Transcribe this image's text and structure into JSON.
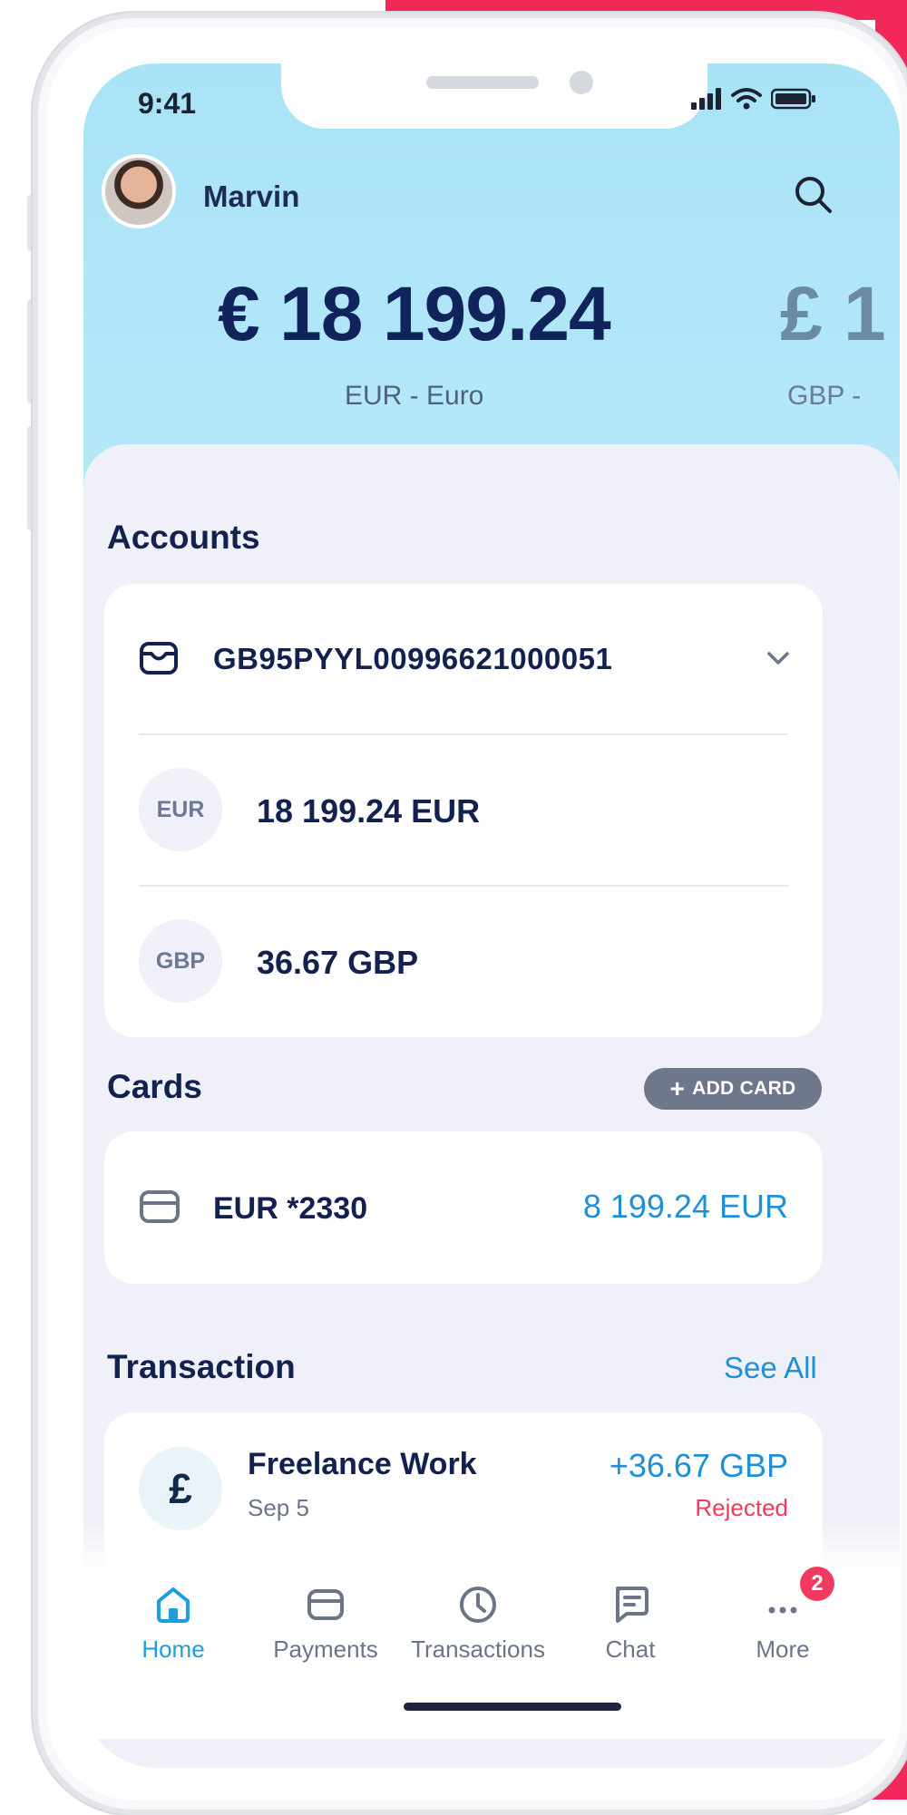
{
  "status_bar": {
    "time": "9:41"
  },
  "header": {
    "user_name": "Marvin",
    "balances": [
      {
        "amount": "€ 18 199.24",
        "currency_label": "EUR - Euro"
      },
      {
        "amount": "£ 1",
        "currency_label": "GBP -"
      }
    ]
  },
  "accounts": {
    "title": "Accounts",
    "iban": "GB95PYYL00996621000051",
    "rows": [
      {
        "badge": "EUR",
        "amount": "18 199.24 EUR"
      },
      {
        "badge": "GBP",
        "amount": "36.67 GBP"
      }
    ]
  },
  "cards": {
    "title": "Cards",
    "add_label": "ADD CARD",
    "items": [
      {
        "name": "EUR *2330",
        "amount": "8 199.24 EUR"
      }
    ]
  },
  "transactions": {
    "title": "Transaction",
    "see_all": "See All",
    "items": [
      {
        "icon_symbol": "£",
        "title": "Freelance Work",
        "date": "Sep 5",
        "amount": "+36.67 GBP",
        "status": "Rejected"
      }
    ]
  },
  "tabbar": {
    "items": [
      {
        "label": "Home",
        "icon": "home-icon"
      },
      {
        "label": "Payments",
        "icon": "card-icon"
      },
      {
        "label": "Transactions",
        "icon": "clock-icon"
      },
      {
        "label": "Chat",
        "icon": "chat-icon"
      },
      {
        "label": "More",
        "icon": "more-icon"
      }
    ],
    "more_badge": "2"
  },
  "colors": {
    "accent": "#1b9fdc",
    "brand_pink": "#f2285a",
    "negative": "#f03a5f",
    "hero_bg": "#aee5f7"
  }
}
